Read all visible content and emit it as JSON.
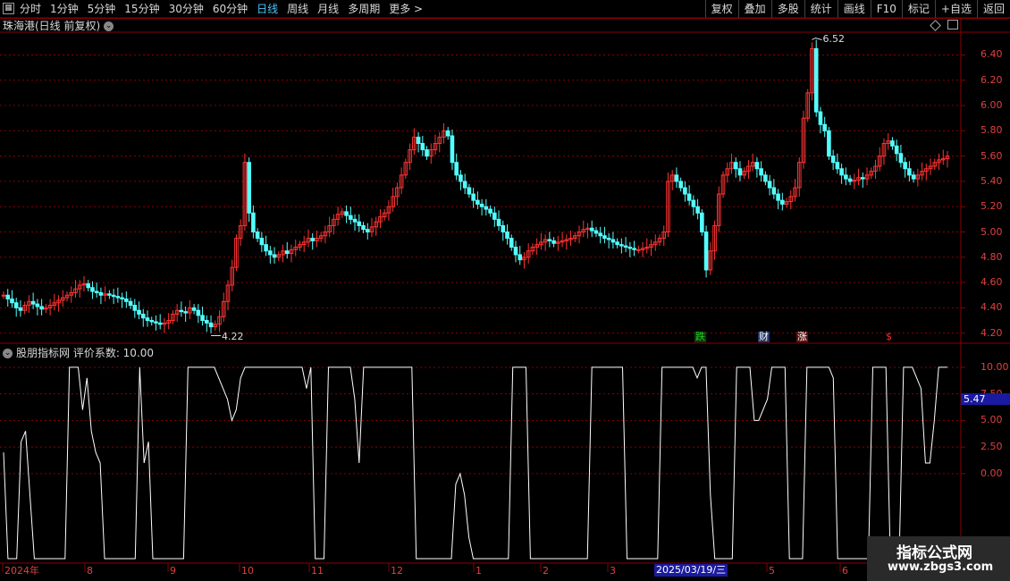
{
  "toolbar": {
    "icon": "grid-icon",
    "periods": [
      "分时",
      "1分钟",
      "5分钟",
      "15分钟",
      "30分钟",
      "60分钟",
      "日线",
      "周线",
      "月线",
      "多周期",
      "更多 >"
    ],
    "active_index": 6,
    "right_buttons": [
      "复权",
      "叠加",
      "多股",
      "统计",
      "画线",
      "F10",
      "标记",
      "+自选",
      "返回"
    ]
  },
  "main_title": "珠海港(日线 前复权)",
  "price_axis": [
    "6.40",
    "6.20",
    "6.00",
    "5.80",
    "5.60",
    "5.40",
    "5.20",
    "5.00",
    "4.80",
    "4.60",
    "4.40",
    "4.20"
  ],
  "price_range": [
    4.12,
    6.58
  ],
  "annotations": {
    "high": "6.52",
    "low": "4.22"
  },
  "markers": [
    {
      "text": "跌",
      "color": "#22cc22",
      "bg": "#0a3a0a"
    },
    {
      "text": "财",
      "color": "#ffffff",
      "bg": "#223366"
    },
    {
      "text": "涨",
      "color": "#ffffff",
      "bg": "#5a1010"
    },
    {
      "text": "$",
      "color": "#ff3030",
      "bg": "transparent"
    }
  ],
  "indicator": {
    "title": "股朋指标网 评价系数: 10.00",
    "axis": [
      "10.00",
      "7.50",
      "5.00",
      "2.50",
      "0.00"
    ],
    "current": "5.47"
  },
  "x_labels": [
    "2024年",
    "8",
    "9",
    "10",
    "11",
    "12",
    "1",
    "2",
    "3",
    "5",
    "6"
  ],
  "date_box": "2025/03/19/三",
  "watermark": {
    "line1": "指标公式网",
    "line2": "www.zbgs3.com"
  },
  "colors": {
    "up": "#ff3333",
    "down": "#54ffff",
    "grid": "#8b0000",
    "axis_text": "#e04040"
  },
  "chart_data": {
    "type": "candlestick",
    "title": "珠海港(日线 前复权)",
    "ylim": [
      4.12,
      6.58
    ],
    "series": [
      {
        "close_path": [
          4.5,
          4.47,
          4.44,
          4.4,
          4.38,
          4.42,
          4.45,
          4.43,
          4.41,
          4.39,
          4.4,
          4.42,
          4.44,
          4.46,
          4.48,
          4.5,
          4.52,
          4.55,
          4.58,
          4.59,
          4.56,
          4.53,
          4.52,
          4.5,
          4.51,
          4.5,
          4.49,
          4.48,
          4.47,
          4.45,
          4.42,
          4.38,
          4.35,
          4.32,
          4.3,
          4.29,
          4.28,
          4.27,
          4.28,
          4.3,
          4.35,
          4.38,
          4.37,
          4.36,
          4.4,
          4.38,
          4.34,
          4.3,
          4.28,
          4.25,
          4.27,
          4.33,
          4.45,
          4.58,
          4.72,
          4.95,
          5.05,
          5.55,
          5.15,
          5.0,
          4.95,
          4.9,
          4.85,
          4.82,
          4.8,
          4.82,
          4.85,
          4.83,
          4.86,
          4.88,
          4.9,
          4.92,
          4.95,
          4.93,
          4.95,
          4.97,
          5.0,
          5.05,
          5.1,
          5.14,
          5.16,
          5.13,
          5.1,
          5.08,
          5.05,
          5.02,
          5.0,
          5.04,
          5.08,
          5.12,
          5.15,
          5.2,
          5.28,
          5.35,
          5.45,
          5.55,
          5.65,
          5.75,
          5.7,
          5.65,
          5.6,
          5.65,
          5.7,
          5.75,
          5.8,
          5.76,
          5.55,
          5.45,
          5.4,
          5.35,
          5.3,
          5.25,
          5.22,
          5.2,
          5.18,
          5.15,
          5.1,
          5.05,
          5.0,
          4.95,
          4.88,
          4.82,
          4.78,
          4.8,
          4.85,
          4.88,
          4.9,
          4.92,
          4.94,
          4.93,
          4.91,
          4.92,
          4.93,
          4.94,
          4.95,
          4.97,
          5.0,
          5.02,
          5.03,
          5.01,
          4.99,
          4.97,
          4.95,
          4.94,
          4.92,
          4.9,
          4.89,
          4.88,
          4.87,
          4.86,
          4.86,
          4.87,
          4.88,
          4.9,
          4.92,
          4.95,
          5.0,
          5.4,
          5.45,
          5.4,
          5.35,
          5.3,
          5.25,
          5.2,
          5.15,
          5.0,
          4.7,
          4.85,
          5.05,
          5.3,
          5.45,
          5.5,
          5.55,
          5.5,
          5.45,
          5.48,
          5.52,
          5.55,
          5.5,
          5.45,
          5.4,
          5.35,
          5.3,
          5.25,
          5.22,
          5.24,
          5.28,
          5.35,
          5.55,
          5.9,
          6.1,
          6.45,
          5.95,
          5.85,
          5.8,
          5.6,
          5.55,
          5.5,
          5.45,
          5.42,
          5.4,
          5.41,
          5.43,
          5.42,
          5.45,
          5.48,
          5.52,
          5.6,
          5.7,
          5.72,
          5.68,
          5.62,
          5.55,
          5.5,
          5.45,
          5.42,
          5.45,
          5.48,
          5.5,
          5.52,
          5.55,
          5.57,
          5.58,
          5.6
        ]
      }
    ],
    "indicator_series": {
      "name": "评价系数",
      "ylim": [
        -8,
        10.5
      ],
      "values": [
        2,
        -8,
        -8,
        -8,
        3,
        4,
        -2,
        -8,
        -8,
        -8,
        -8,
        -8,
        -8,
        -8,
        -8,
        10,
        10,
        10,
        6,
        9,
        4,
        2,
        1,
        -8,
        -8,
        -8,
        -8,
        -8,
        -8,
        -8,
        -8,
        10,
        1,
        3,
        -8,
        -8,
        -8,
        -8,
        -8,
        -8,
        -8,
        -8,
        10,
        10,
        10,
        10,
        10,
        10,
        10,
        9,
        8,
        7,
        5,
        6,
        9,
        10,
        10,
        10,
        10,
        10,
        10,
        10,
        10,
        10,
        10,
        10,
        10,
        10,
        10,
        8,
        10,
        -8,
        -8,
        -8,
        10,
        10,
        10,
        10,
        10,
        10,
        7,
        1,
        10,
        10,
        10,
        10,
        10,
        10,
        10,
        10,
        10,
        10,
        10,
        10,
        -8,
        -8,
        -8,
        -8,
        -8,
        -8,
        -8,
        -8,
        -8,
        -1,
        0,
        -2,
        -6,
        -8,
        -8,
        -8,
        -8,
        -8,
        -8,
        -8,
        -8,
        -8,
        10,
        10,
        10,
        10,
        -8,
        -8,
        -8,
        -8,
        -8,
        -8,
        -8,
        -8,
        -8,
        -8,
        -8,
        -8,
        -8,
        -8,
        10,
        10,
        10,
        10,
        10,
        10,
        10,
        10,
        -8,
        -8,
        -8,
        -8,
        -8,
        -8,
        -8,
        -8,
        10,
        10,
        10,
        10,
        10,
        10,
        10,
        10,
        9,
        10,
        10,
        -2,
        -8,
        -8,
        -8,
        -8,
        -8,
        10,
        10,
        10,
        10,
        5,
        5,
        6,
        7,
        10,
        10,
        10,
        10,
        -8,
        -8,
        -8,
        -8,
        10,
        10,
        10,
        10,
        10,
        10,
        9,
        -8,
        -8,
        -8,
        -8,
        -8,
        -8,
        -8,
        -8,
        10,
        10,
        10,
        10,
        -8,
        -8,
        -8,
        10,
        10,
        10,
        9,
        8,
        1,
        1,
        5,
        10,
        10,
        10
      ]
    }
  }
}
